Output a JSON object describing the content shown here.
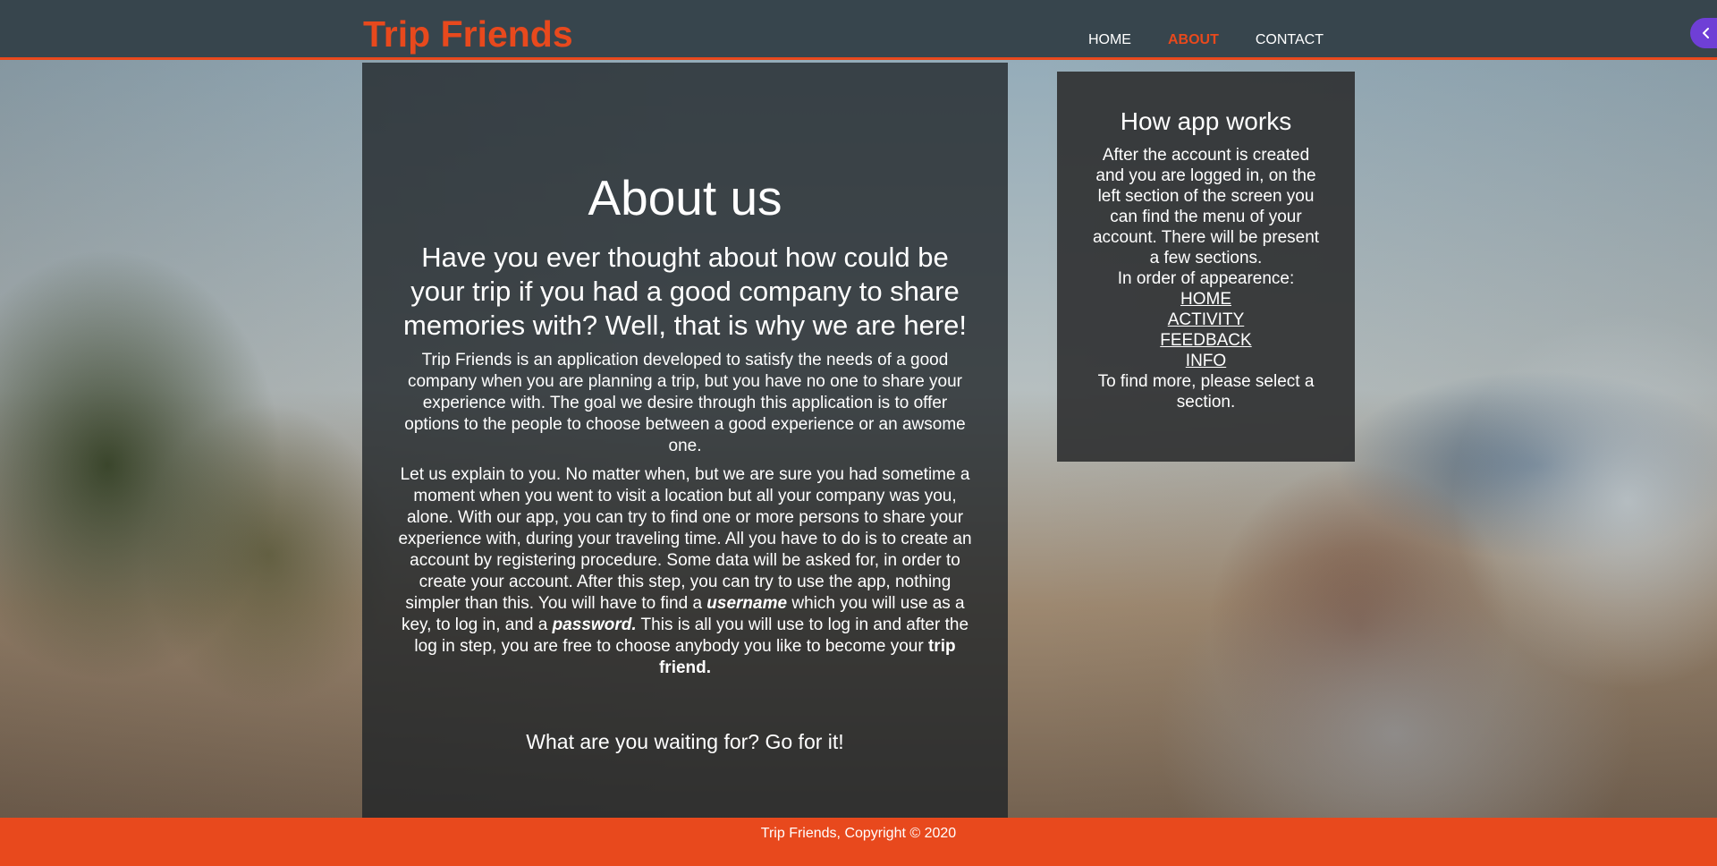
{
  "header": {
    "logo": "Trip Friends",
    "nav": [
      {
        "label": "HOME",
        "active": false
      },
      {
        "label": "ABOUT",
        "active": true
      },
      {
        "label": "CONTACT",
        "active": false
      }
    ],
    "side_toggle_icon": "chevron-left-icon"
  },
  "main": {
    "title": "About us",
    "subtitle": "Have you ever thought about how could be your trip if you had a good company to share memories with? Well, that is why we are here!",
    "paragraph1": "Trip Friends is an application developed to satisfy the needs of a good company when you are planning a trip, but you have no one to share your experience with. The goal we desire through this application is to offer options to the people to choose between a good experience or an awsome one.",
    "paragraph2": {
      "part1": "Let us explain to you. No matter when, but we are sure you had sometime a moment when you went to visit a location but all your company was you, alone. With our app, you can try to find one or more persons to share your experience with, during your traveling time. All you have to do is to create an account by registering procedure. Some data will be asked for, in order to create your account. After this step, you can try to use the app, nothing simpler than this. You will have to find a ",
      "username": "username",
      "part2": " which you will use as a key, to log in, and a ",
      "password": "password.",
      "part3": " This is all you will use to log in and after the log in step, you are free to choose anybody you like to become your ",
      "trip_friend": "trip friend."
    },
    "cta": "What are you waiting for? Go for it!"
  },
  "sidebar": {
    "title": "How app works",
    "intro": "After the account is created and you are logged in, on the left section of the screen you can find the menu of your account. There will be present a few sections.",
    "order_label": "In order of appearence:",
    "links": [
      "HOME",
      "ACTIVITY",
      "FEEDBACK",
      "INFO"
    ],
    "outro": "To find more, please select a section."
  },
  "footer": {
    "text": "Trip Friends, Copyright © 2020"
  },
  "colors": {
    "accent": "#e8491d",
    "header_bg": "#37454d",
    "toggle": "#6f3fd6"
  }
}
